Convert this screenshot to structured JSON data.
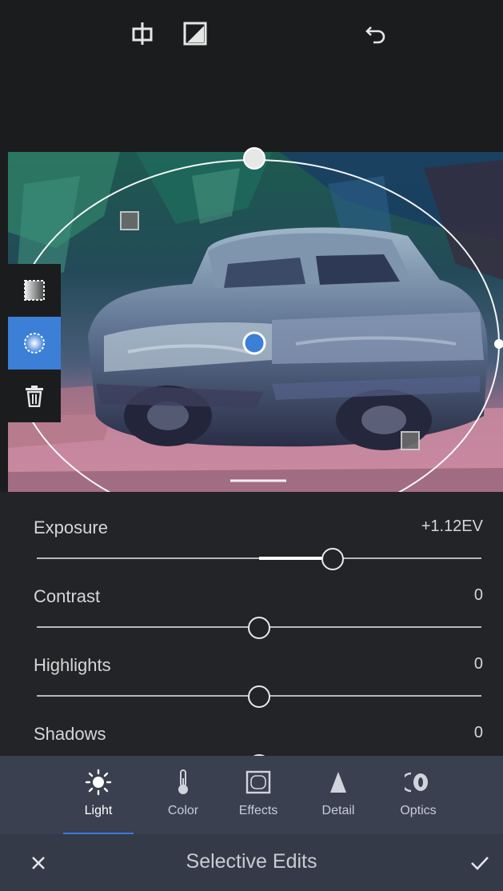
{
  "toolbar": {
    "icons": [
      "crop-icon",
      "before-after-icon",
      "undo-icon"
    ]
  },
  "side_tools": [
    "linear-gradient-tool-icon",
    "radial-gradient-tool-icon",
    "delete-icon"
  ],
  "sliders": [
    {
      "label": "Exposure",
      "value": "+1.12EV",
      "level": 0.665
    },
    {
      "label": "Contrast",
      "value": "0",
      "level": 0.5
    },
    {
      "label": "Highlights",
      "value": "0",
      "level": 0.5
    },
    {
      "label": "Shadows",
      "value": "0",
      "level": 0.5
    }
  ],
  "tabs": [
    {
      "label": "Light",
      "icon": "sun-icon",
      "active": true
    },
    {
      "label": "Color",
      "icon": "thermometer-icon",
      "active": false
    },
    {
      "label": "Effects",
      "icon": "vignette-icon",
      "active": false
    },
    {
      "label": "Detail",
      "icon": "triangle-icon",
      "active": false
    },
    {
      "label": "Optics",
      "icon": "lens-icon",
      "active": false
    }
  ],
  "bottom": {
    "title": "Selective Edits",
    "cancel_icon": "close-icon",
    "confirm_icon": "checkmark-icon"
  },
  "colors": {
    "accent": "#3b7fd6",
    "background": "#1b1c1e",
    "tabbar": "#3a4050"
  }
}
